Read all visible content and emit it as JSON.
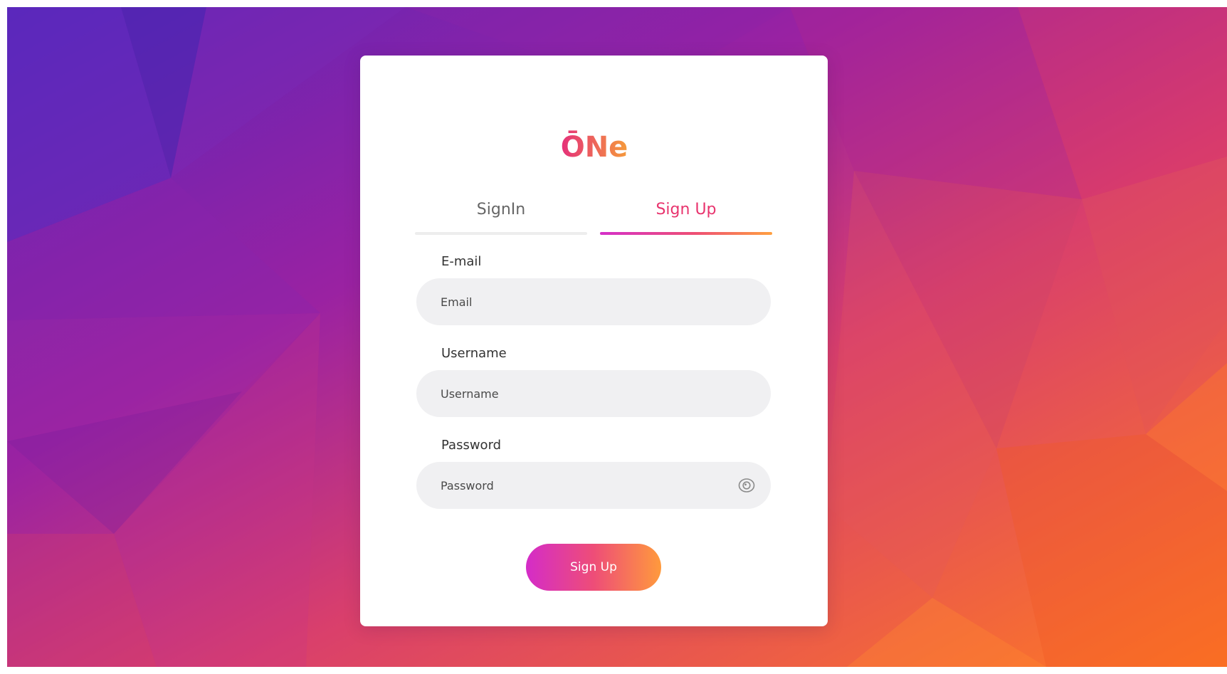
{
  "brand": {
    "logo_text": "ŌNe"
  },
  "tabs": [
    {
      "label": "SignIn",
      "active": false
    },
    {
      "label": "Sign Up",
      "active": true
    }
  ],
  "form": {
    "email": {
      "label": "E-mail",
      "placeholder": "Email",
      "value": ""
    },
    "username": {
      "label": "Username",
      "placeholder": "Username",
      "value": ""
    },
    "password": {
      "label": "Password",
      "placeholder": "Password",
      "value": "",
      "toggle_icon": "eye-icon"
    },
    "submit_label": "Sign Up"
  },
  "colors": {
    "accent_pink": "#e8346e",
    "accent_magenta": "#d42fc9",
    "accent_orange": "#ffa040",
    "field_bg": "#f0f0f2",
    "card_bg": "#ffffff"
  }
}
